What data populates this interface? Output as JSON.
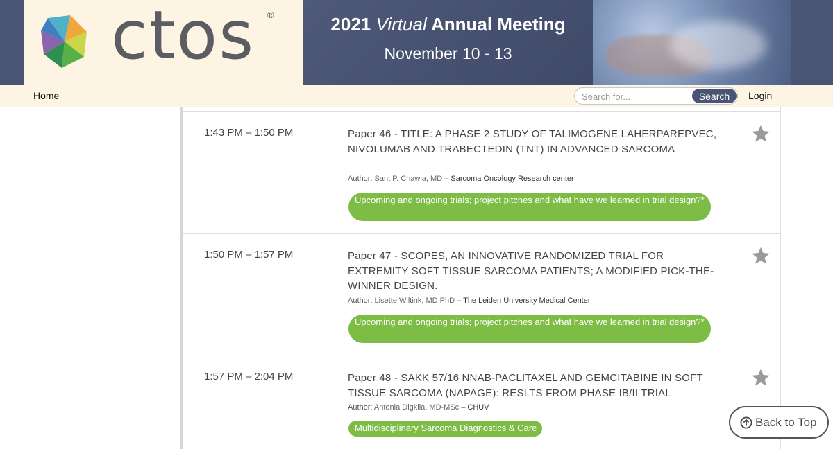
{
  "header": {
    "logo_text": "ctos",
    "logo_registered": "®",
    "meeting_year": "2021",
    "meeting_virtual": "Virtual",
    "meeting_name": "Annual Meeting",
    "meeting_dates": "November 10 - 13"
  },
  "nav": {
    "home": "Home",
    "search_placeholder": "Search for...",
    "search_button": "Search",
    "login": "Login"
  },
  "sessions": [
    {
      "time": "1:43 PM – 1:50 PM",
      "title": "Paper 46 - TITLE: A PHASE 2 STUDY OF TALIMOGENE LAHERPAREPVEC, NIVOLUMAB AND TRABECTEDIN (TNT) IN ADVANCED SARCOMA",
      "author_label": "Author:",
      "author_name": "Sant P. Chawla, MD",
      "author_affiliation": "– Sarcoma Oncology Research center",
      "track": "Upcoming and ongoing trials; project pitches and what have we learned in trial design?*",
      "favorite_icon": "star-icon"
    },
    {
      "time": "1:50 PM – 1:57 PM",
      "title": "Paper 47 - SCOPES, AN INNOVATIVE RANDOMIZED TRIAL FOR EXTREMITY SOFT TISSUE SARCOMA PATIENTS; A MODIFIED PICK-THE-WINNER DESIGN.",
      "author_label": "Author:",
      "author_name": "Lisette Wiltink, MD PhD",
      "author_affiliation": "– The Leiden University Medical Center",
      "track": "Upcoming and ongoing trials; project pitches and what have we learned in trial design?*",
      "favorite_icon": "star-icon"
    },
    {
      "time": "1:57 PM – 2:04 PM",
      "title": "Paper 48 - SAKK 57/16 NNAB-PACLITAXEL AND GEMCITABINE IN SOFT TISSUE SARCOMA (NAPAGE): RESLTS FROM PHASE IB/II TRIAL",
      "author_label": "Author:",
      "author_name": "Antonia Digklia, MD-MSc",
      "author_affiliation": "– CHUV",
      "track": "Multidisciplinary Sarcoma Diagnostics & Care",
      "favorite_icon": "star-icon"
    }
  ],
  "back_to_top": "Back to Top",
  "colors": {
    "banner": "#4a5574",
    "cream": "#fdf4e3",
    "track_green": "#7dbd45",
    "star_gray": "#9a9a9a"
  }
}
